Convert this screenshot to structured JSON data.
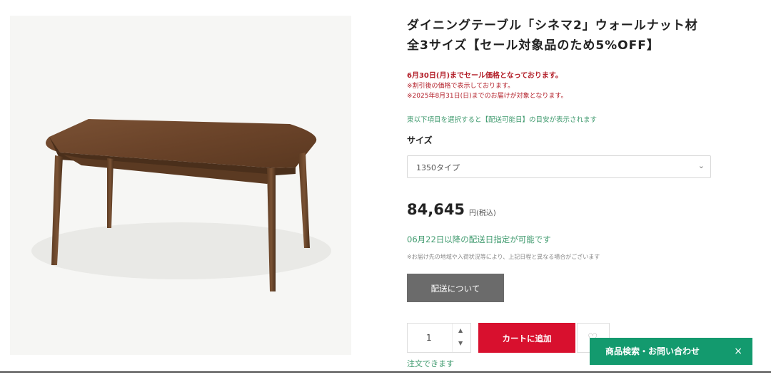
{
  "product": {
    "title": "ダイニングテーブル「シネマ2」ウォールナット材 全3サイズ【セール対象品のため5%OFF】",
    "image_alt": "dining-table-photo"
  },
  "notice": {
    "main": "6月30日(月)までセール価格となっております。",
    "line2": "※割引後の価格で表示しております。",
    "line3": "※2025年8月31日(日)までのお届けが対象となります。"
  },
  "delivery_hint": "東以下項目を選択すると【配送可能日】の目安が表示されます",
  "size": {
    "label": "サイズ",
    "selected": "1350タイプ"
  },
  "price": {
    "amount": "84,645",
    "unit": "円(税込)"
  },
  "delivery": {
    "date_note": "06月22日以降の配送日指定が可能です",
    "sub_note": "※お届け先の地域や入荷状況等により、上記日程と異なる場合がございます",
    "button": "配送について"
  },
  "cart": {
    "quantity": "1",
    "add_button": "カートに追加",
    "order_status": "注文できます"
  },
  "contact_bar": {
    "label": "商品検索・お問い合わせ",
    "close": "×"
  },
  "colors": {
    "accent_red": "#d8102e",
    "green": "#139a6e",
    "notice_red": "#b3202a"
  }
}
